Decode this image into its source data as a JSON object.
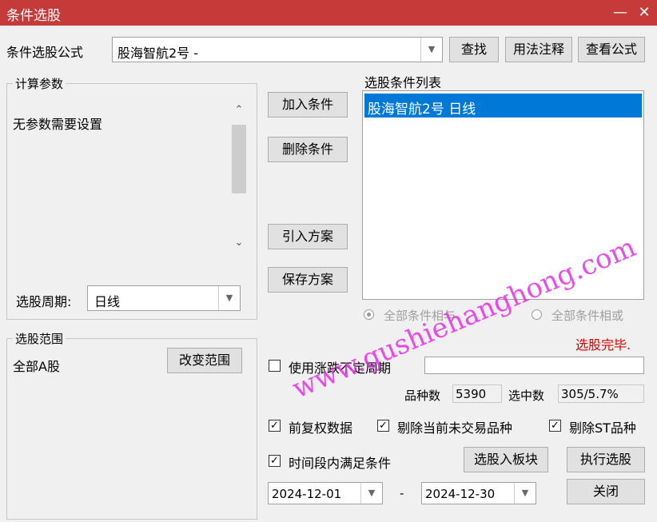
{
  "window": {
    "title": "条件选股",
    "minimize_glyph": "—",
    "close_glyph": "✕"
  },
  "formula": {
    "label": "条件选股公式",
    "value": "股海智航2号  -",
    "buttons": {
      "find": "查找",
      "usage": "用法注释",
      "view": "查看公式"
    }
  },
  "params": {
    "legend": "计算参数",
    "message": "无参数需要设置",
    "period_label": "选股周期:",
    "period_value": "日线"
  },
  "condition_buttons": {
    "add": "加入条件",
    "remove": "删除条件",
    "import": "引入方案",
    "save": "保存方案"
  },
  "condition_list": {
    "legend": "选股条件列表",
    "items": [
      "股海智航2号  日线"
    ]
  },
  "logic": {
    "and_label": "全部条件相与",
    "or_label": "全部条件相或"
  },
  "range": {
    "legend": "选股范围",
    "value": "全部A股",
    "change_button": "改变范围"
  },
  "rate_label": "选股完毕.",
  "variable_period": {
    "label": "使用涨跌不定周期",
    "checked": false
  },
  "counts": {
    "stock_label": "品种数",
    "stock_value": "5390",
    "selected_label": "选中数",
    "selected_value": "305/5.7%"
  },
  "options": {
    "adjusted": {
      "label": "前复权数据",
      "checked": true
    },
    "exclude_suspended": {
      "label": "剔除当前未交易品种",
      "checked": true
    },
    "exclude_st": {
      "label": "剔除ST品种",
      "checked": true
    },
    "time_range": {
      "label": "时间段内满足条件",
      "checked": true
    }
  },
  "dates": {
    "start": "2024-12-01",
    "separator": "-",
    "end": "2024-12-30"
  },
  "actions": {
    "to_board": "选股入板块",
    "execute": "执行选股",
    "close": "关闭"
  },
  "watermark": "www.gushiehanghong.com",
  "colors": {
    "title_bar": "#c73a3a",
    "selection": "#0078d7",
    "rate_text": "#e00000"
  }
}
